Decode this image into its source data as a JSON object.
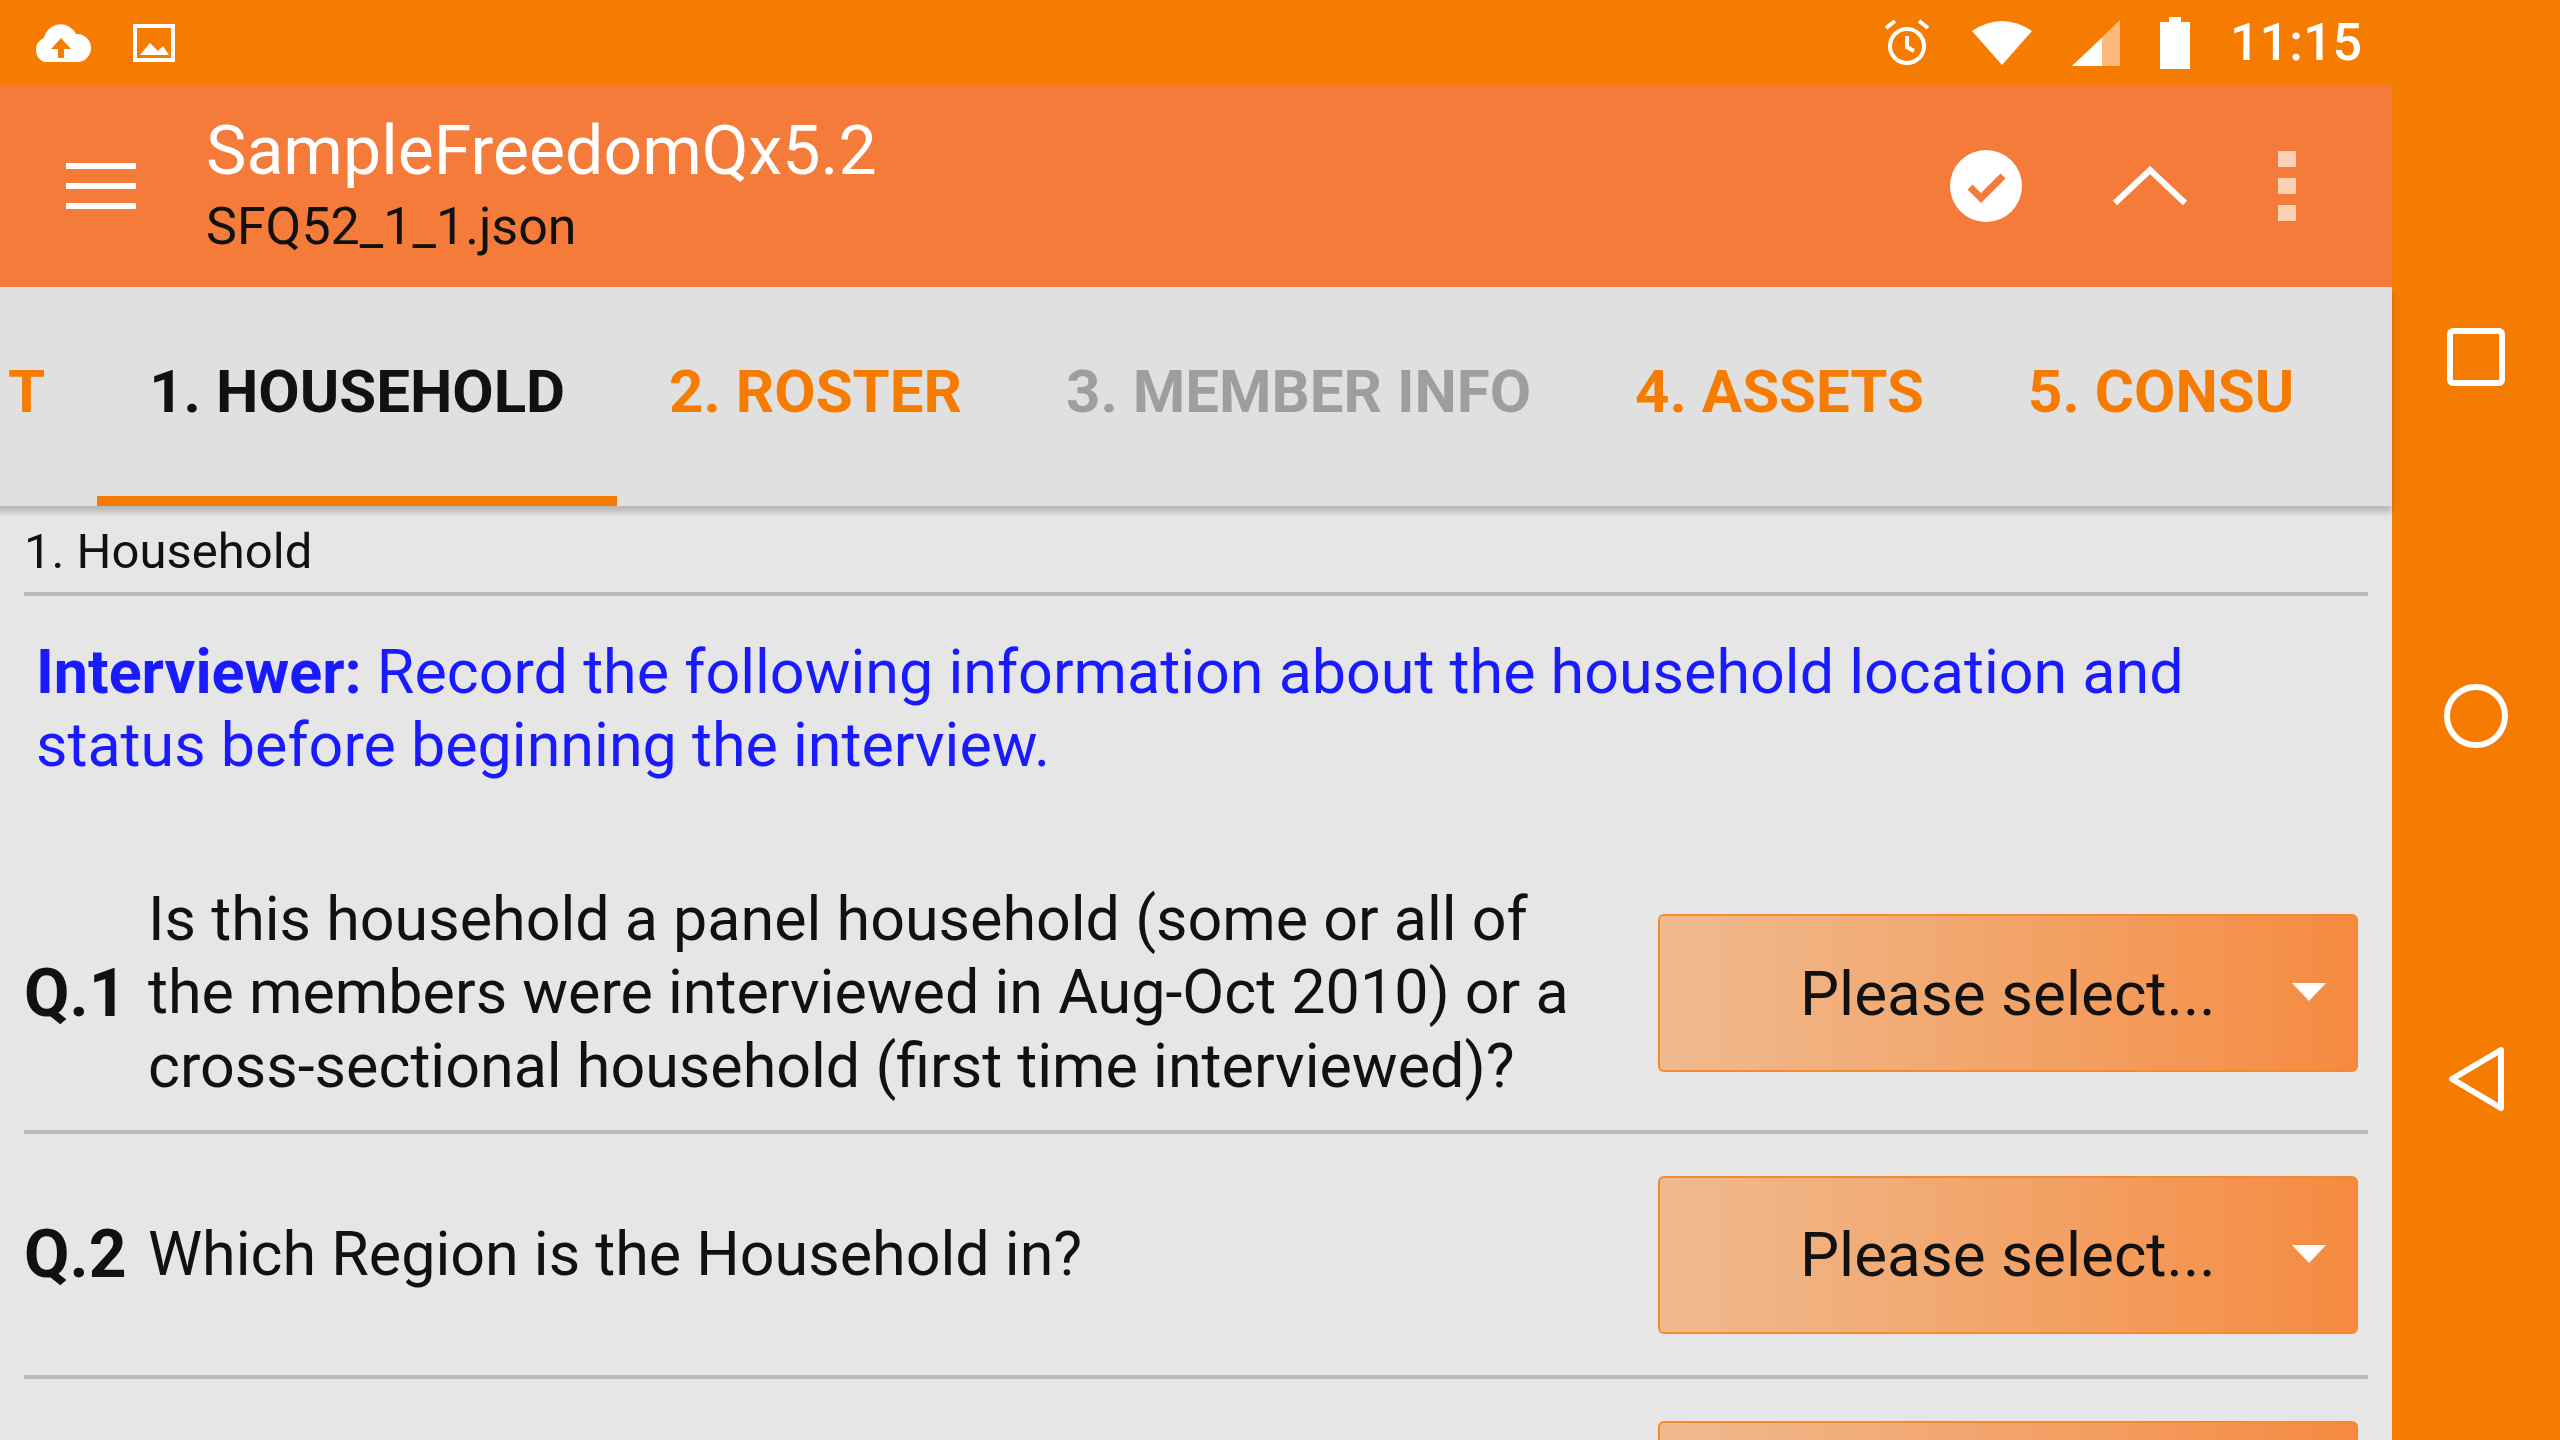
{
  "status_bar": {
    "time": "11:15"
  },
  "app_bar": {
    "title": "SampleFreedomQx5.2",
    "subtitle": "SFQ52_1_1.json"
  },
  "tabs": [
    {
      "label": "T",
      "selected": false,
      "color": "#f57c00"
    },
    {
      "label": "1. HOUSEHOLD",
      "selected": true,
      "color": "#111111"
    },
    {
      "label": "2. ROSTER",
      "selected": false,
      "color": "#f57c00"
    },
    {
      "label": "3. MEMBER INFO",
      "selected": false,
      "color": "#9e9e9e"
    },
    {
      "label": "4. ASSETS",
      "selected": false,
      "color": "#f57c00"
    },
    {
      "label": "5. CONSU",
      "selected": false,
      "color": "#f57c00"
    }
  ],
  "section": {
    "title": "1. Household"
  },
  "instruction": "**Interviewer:** Record the following information about the household location and status before beginning the interview.",
  "questions": [
    {
      "number": "Q.1",
      "text": "Is this household a panel household (some or all of the members were interviewed in Aug-Oct 2010) or a cross-sectional household (first time interviewed)?",
      "placeholder": "Please select..."
    },
    {
      "number": "Q.2",
      "text": "Which Region is the Household in?",
      "placeholder": "Please select..."
    }
  ]
}
